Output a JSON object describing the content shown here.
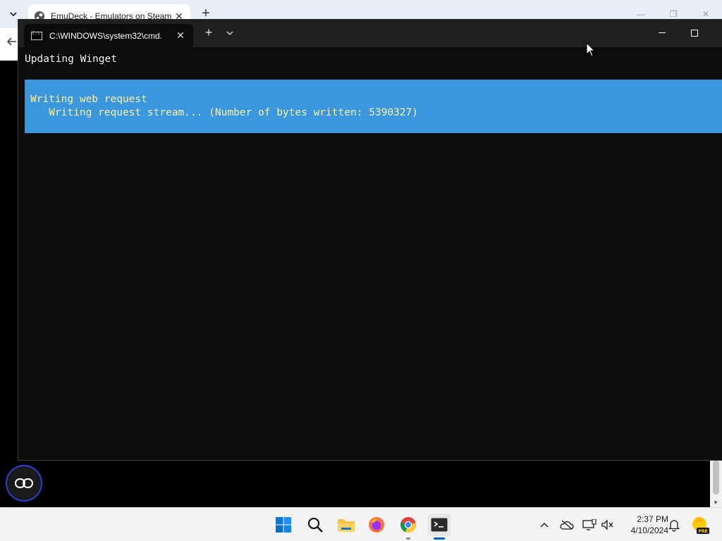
{
  "browser": {
    "tab_title": "EmuDeck - Emulators on Steam",
    "colors": {
      "tabstrip": "#e9eef6"
    }
  },
  "terminal": {
    "tab_title": "C:\\WINDOWS\\system32\\cmd.",
    "line1": "Updating Winget",
    "progress_line1": "Writing web request",
    "progress_line2": "   Writing request stream... (Number of bytes written: 5390327)",
    "colors": {
      "background": "#0c0c0c",
      "progress_bg": "#3a96dd",
      "progress_fg": "#f9f1a5"
    }
  },
  "taskbar": {
    "pinned": [
      {
        "name": "start-button",
        "icon": "windows-logo"
      },
      {
        "name": "search-button",
        "icon": "search-icon"
      },
      {
        "name": "file-explorer",
        "icon": "folder-icon"
      },
      {
        "name": "firefox",
        "icon": "firefox-icon"
      },
      {
        "name": "chrome",
        "icon": "chrome-icon"
      },
      {
        "name": "terminal",
        "icon": "terminal-icon",
        "active": true
      }
    ],
    "tray": [
      "chevron-up-icon",
      "onedrive-icon",
      "network-icon",
      "volume-muted-icon"
    ],
    "time": "2:37 PM",
    "date": "4/10/2024",
    "badge_text": "PRE"
  }
}
